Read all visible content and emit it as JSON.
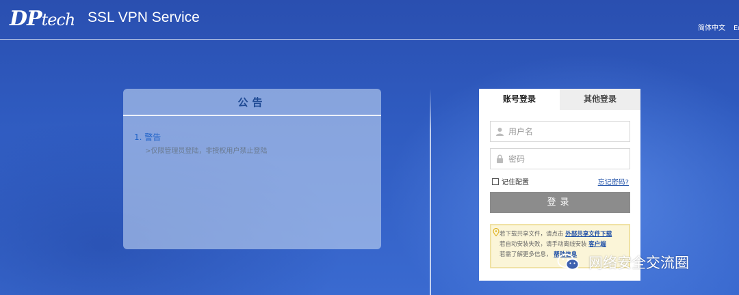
{
  "header": {
    "logo_main": "DP",
    "logo_sub": "tech",
    "title": "SSL VPN Service",
    "lang_current": "简体中文",
    "lang_other": "En"
  },
  "notice": {
    "title": "公告",
    "item_title": "1. 警告",
    "item_text": ">仅限管理员登陆，非授权用户禁止登陆"
  },
  "login": {
    "tabs": [
      "账号登录",
      "其他登录"
    ],
    "username_placeholder": "用户名",
    "password_placeholder": "密码",
    "remember_label": "记住配置",
    "forgot_label": "忘记密码?",
    "submit_label": "登录",
    "tip": {
      "line1_text": "若下载共享文件，请点击",
      "line1_link": "外部共享文件下载",
      "line2_text": "若自动安装失败，请手动离线安装",
      "line2_link": "客户端",
      "line3_text": "若需了解更多信息，",
      "line3_link": "帮助信息"
    }
  },
  "watermark": {
    "text": "网络安全交流圈",
    "icon": "wechat-icon"
  },
  "colors": {
    "accent": "#1f4a94",
    "button": "#8c8c8c",
    "tip_bg": "#fbf5d8"
  }
}
